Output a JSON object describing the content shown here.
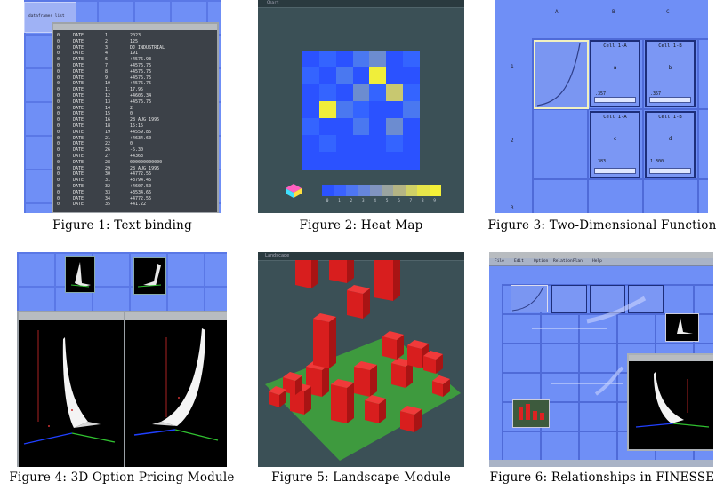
{
  "figures": [
    {
      "number": "Figure 1:",
      "title": "Text binding"
    },
    {
      "number": "Figure 2:",
      "title": "Heat Map"
    },
    {
      "number": "Figure 3:",
      "title": "Two-Dimensional Function"
    },
    {
      "number": "Figure 4:",
      "title": "3D Option Pricing Module"
    },
    {
      "number": "Figure 5:",
      "title": "Landscape Module"
    },
    {
      "number": "Figure 6:",
      "title": "Relationships in FINESSE"
    }
  ],
  "fig1": {
    "tab_label": "dataframes list",
    "rows": [
      [
        "0",
        "DATE",
        "1",
        "2023"
      ],
      [
        "0",
        "DATE",
        "2",
        "125"
      ],
      [
        "0",
        "DATE",
        "3",
        "DJ INDUSTRIAL"
      ],
      [
        "0",
        "DATE",
        "4",
        "191"
      ],
      [
        "0",
        "DATE",
        "6",
        "+4576.93"
      ],
      [
        "0",
        "DATE",
        "7",
        "+4576.75"
      ],
      [
        "0",
        "DATE",
        "8",
        "+4576.75"
      ],
      [
        "0",
        "DATE",
        "9",
        "+4576.75"
      ],
      [
        "0",
        "DATE",
        "10",
        "+4576.75"
      ],
      [
        "0",
        "DATE",
        "11",
        "17.95"
      ],
      [
        "0",
        "DATE",
        "12",
        "+4606.34"
      ],
      [
        "0",
        "DATE",
        "13",
        "+4576.75"
      ],
      [
        "0",
        "DATE",
        "14",
        "2"
      ],
      [
        "0",
        "DATE",
        "15",
        "0"
      ],
      [
        "0",
        "DATE",
        "16",
        "28 AUG 1995"
      ],
      [
        "0",
        "DATE",
        "18",
        "15:15"
      ],
      [
        "0",
        "DATE",
        "19",
        "+4559.85"
      ],
      [
        "0",
        "DATE",
        "21",
        "+4634.60"
      ],
      [
        "0",
        "DATE",
        "22",
        "0"
      ],
      [
        "0",
        "DATE",
        "26",
        "-5.30"
      ],
      [
        "0",
        "DATE",
        "27",
        "+4363"
      ],
      [
        "0",
        "DATE",
        "28",
        "000000000000"
      ],
      [
        "0",
        "DATE",
        "29",
        "28 AUG 1995"
      ],
      [
        "0",
        "DATE",
        "30",
        "+4772.55"
      ],
      [
        "0",
        "DATE",
        "31",
        "+3794.45"
      ],
      [
        "0",
        "DATE",
        "32",
        "+4607.50"
      ],
      [
        "0",
        "DATE",
        "33",
        "+3534.65"
      ],
      [
        "0",
        "DATE",
        "34",
        "+4772.55"
      ],
      [
        "0",
        "DATE",
        "35",
        "+41.22"
      ]
    ]
  },
  "fig2": {
    "title": "Chart",
    "legend_ticks": [
      "0",
      "1",
      "2",
      "3",
      "4",
      "5",
      "6",
      "7",
      "8",
      "9"
    ]
  },
  "fig3": {
    "col_labels": [
      "A",
      "B",
      "C"
    ],
    "row_labels": [
      "1",
      "2",
      "3"
    ],
    "cells": [
      {
        "header": "Cell 1-A",
        "label": "a",
        "value": ".357"
      },
      {
        "header": "Cell 1-B",
        "label": "b",
        "value": ".357"
      },
      {
        "header": "Cell 1-A",
        "label": "c",
        "value": ".383"
      },
      {
        "header": "Cell 1-B",
        "label": "d",
        "value": "1.300"
      }
    ]
  },
  "fig5": {
    "title": "Landscape"
  },
  "fig6": {
    "menu": [
      "File",
      "Edit",
      "Option",
      "Relation",
      "Plan",
      "Help"
    ]
  },
  "colors": {
    "workspace_blue": "#6f8ff6",
    "heat_low": "#2b52ff",
    "heat_high": "#f0ee3a",
    "bar_red": "#e02020",
    "ground_green": "#3e9a3e"
  }
}
